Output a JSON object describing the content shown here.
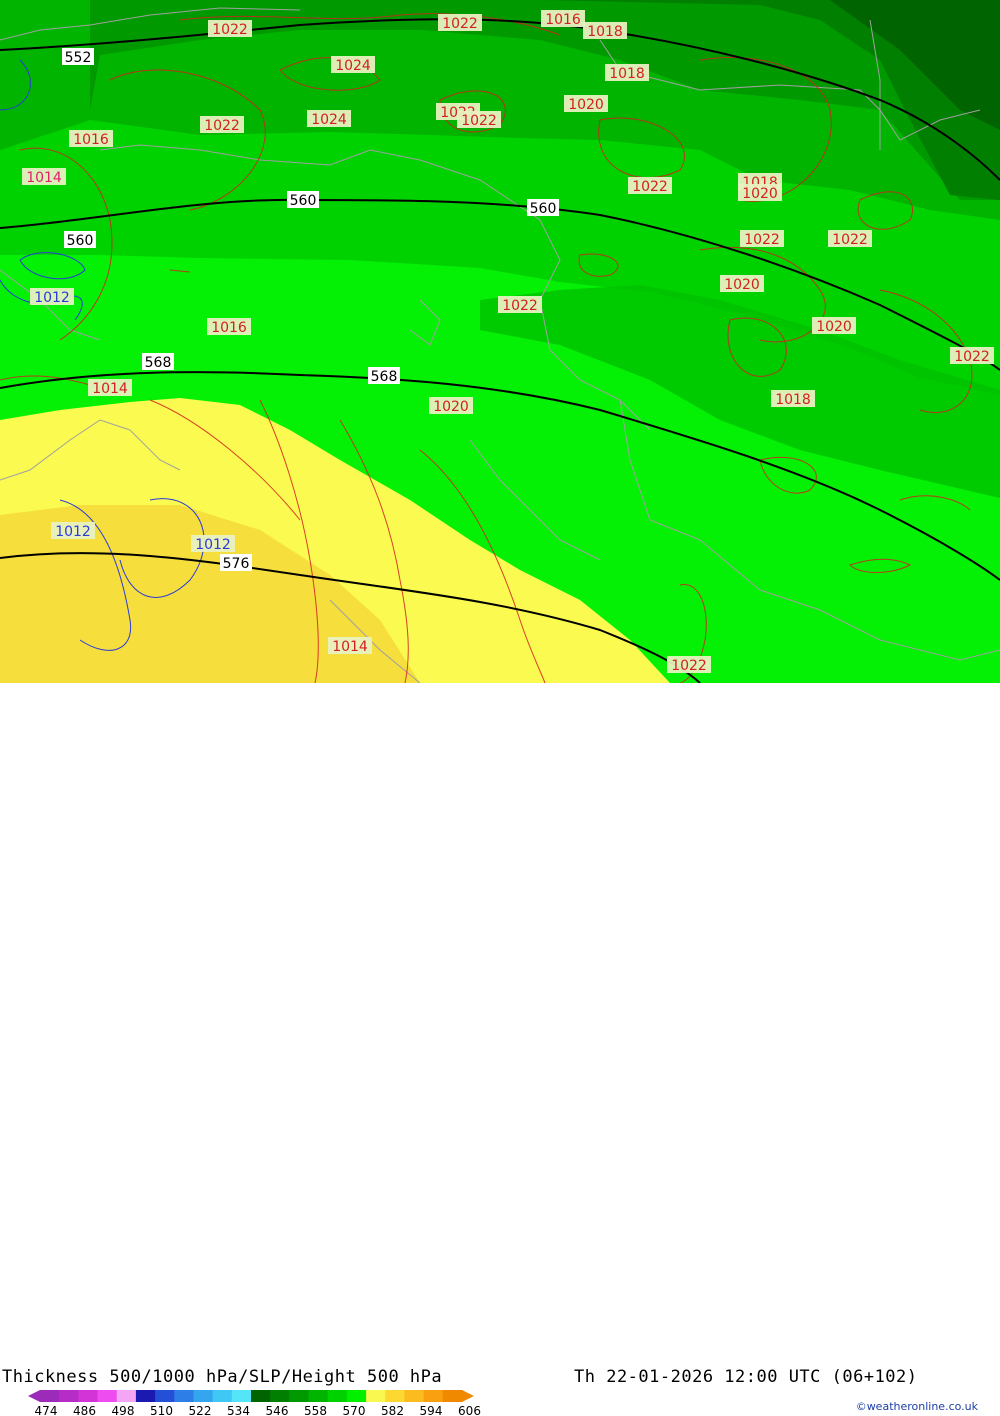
{
  "map": {
    "thickness_labels": [
      {
        "text": "552"
      },
      {
        "text": "560"
      },
      {
        "text": "560"
      },
      {
        "text": "560"
      },
      {
        "text": "568"
      },
      {
        "text": "568"
      },
      {
        "text": "576"
      }
    ],
    "pressure_labels": [
      {
        "text": "1022",
        "color": "#d42020"
      },
      {
        "text": "1022",
        "color": "#d42020"
      },
      {
        "text": "1016",
        "color": "#d42020"
      },
      {
        "text": "1018",
        "color": "#d42020"
      },
      {
        "text": "1024",
        "color": "#d42020"
      },
      {
        "text": "1018",
        "color": "#d42020"
      },
      {
        "text": "1016",
        "color": "#d42020"
      },
      {
        "text": "1022",
        "color": "#d42020"
      },
      {
        "text": "1024",
        "color": "#d42020"
      },
      {
        "text": "1022",
        "color": "#d42020"
      },
      {
        "text": "1022",
        "color": "#d42020"
      },
      {
        "text": "1020",
        "color": "#d42020"
      },
      {
        "text": "1022",
        "color": "#d42020"
      },
      {
        "text": "1018",
        "color": "#d42020"
      },
      {
        "text": "1020",
        "color": "#d42020"
      },
      {
        "text": "1022",
        "color": "#d42020"
      },
      {
        "text": "1022",
        "color": "#d42020"
      },
      {
        "text": "1020",
        "color": "#d42020"
      },
      {
        "text": "1022",
        "color": "#d42020"
      },
      {
        "text": "1020",
        "color": "#d42020"
      },
      {
        "text": "1016",
        "color": "#d42020"
      },
      {
        "text": "1014",
        "color": "#d42020"
      },
      {
        "text": "1020",
        "color": "#d42020"
      },
      {
        "text": "1018",
        "color": "#d42020"
      },
      {
        "text": "1022",
        "color": "#d42020"
      },
      {
        "text": "1014",
        "color": "#d42020"
      },
      {
        "text": "1022",
        "color": "#d42020"
      },
      {
        "text": "1014",
        "color": "#e0206e"
      },
      {
        "text": "1012",
        "color": "#2a3cd8"
      },
      {
        "text": "1012",
        "color": "#2a3cd8"
      },
      {
        "text": "1012",
        "color": "#2a3cd8"
      }
    ]
  },
  "footer": {
    "title_left": "Thickness 500/1000 hPa/SLP/Height 500 hPa",
    "title_right": "Th 22-01-2026 12:00 UTC (06+102)",
    "credit": "©weatheronline.co.uk"
  },
  "colorbar": {
    "ticks": [
      "474",
      "486",
      "498",
      "510",
      "522",
      "534",
      "546",
      "558",
      "570",
      "582",
      "594",
      "606"
    ],
    "colors": [
      "#9b2bb8",
      "#b52cc7",
      "#d234d8",
      "#ee4cf0",
      "#f4a6f4",
      "#1a1ab0",
      "#2450d8",
      "#2e7ee8",
      "#34a6f0",
      "#40c8f4",
      "#54e6f8",
      "#006400",
      "#007f00",
      "#009a00",
      "#00b400",
      "#00d200",
      "#00f000",
      "#f8f850",
      "#fcd830",
      "#fcbc20",
      "#f8a010",
      "#f08800"
    ]
  }
}
